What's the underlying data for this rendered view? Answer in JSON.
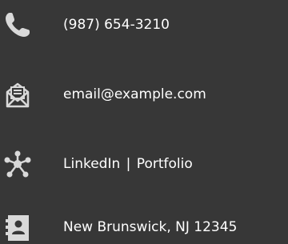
{
  "contact": {
    "phone": {
      "icon": "phone-icon",
      "text": "(987) 654-3210"
    },
    "email": {
      "icon": "email-icon",
      "text": "email@example.com"
    },
    "links": {
      "icon": "network-icon",
      "linkedin": "LinkedIn",
      "separator": "|",
      "portfolio": "Portfolio"
    },
    "location": {
      "icon": "contact-card-icon",
      "text": "New Brunswick, NJ 12345"
    }
  },
  "colors": {
    "background": "#373737",
    "text": "#ffffff",
    "icon": "#d9d9d9"
  }
}
